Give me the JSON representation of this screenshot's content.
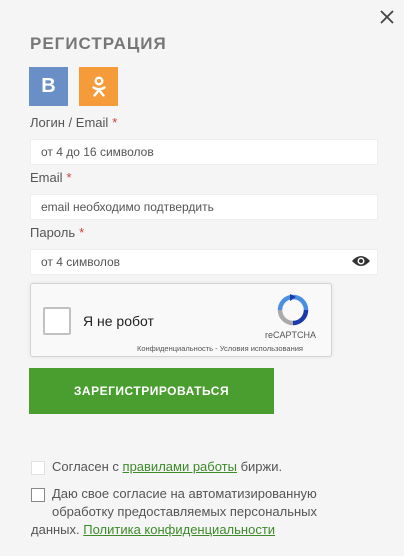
{
  "title": "РЕГИСТРАЦИЯ",
  "social": {
    "vk_label": "В",
    "ok_label": "ok"
  },
  "login": {
    "label": "Логин / Email",
    "required": "*",
    "placeholder": "от 4 до 16 символов"
  },
  "email": {
    "label": "Email",
    "required": "*",
    "placeholder": "email необходимо подтвердить"
  },
  "password": {
    "label": "Пароль",
    "required": "*",
    "placeholder": "от 4 символов"
  },
  "captcha": {
    "label": "Я не робот",
    "brand": "reCAPTCHA",
    "privacy": "Конфиденциальность",
    "separator": " - ",
    "terms": "Условия использования"
  },
  "submit_label": "ЗАРЕГИСТРИРОВАТЬСЯ",
  "agree_rules": {
    "prefix": "Согласен с ",
    "link": "правилами работы",
    "suffix": " биржи."
  },
  "agree_data": {
    "line1": "Даю свое согласие на автоматизированную",
    "line2": "обработку предоставляемых персональных",
    "prefix3": "данных. ",
    "link": "Политика конфиденциальности"
  },
  "colors": {
    "accent": "#4a9e2f",
    "vk": "#6a8fc7",
    "ok": "#f59b3a",
    "required": "#d23c3c"
  }
}
